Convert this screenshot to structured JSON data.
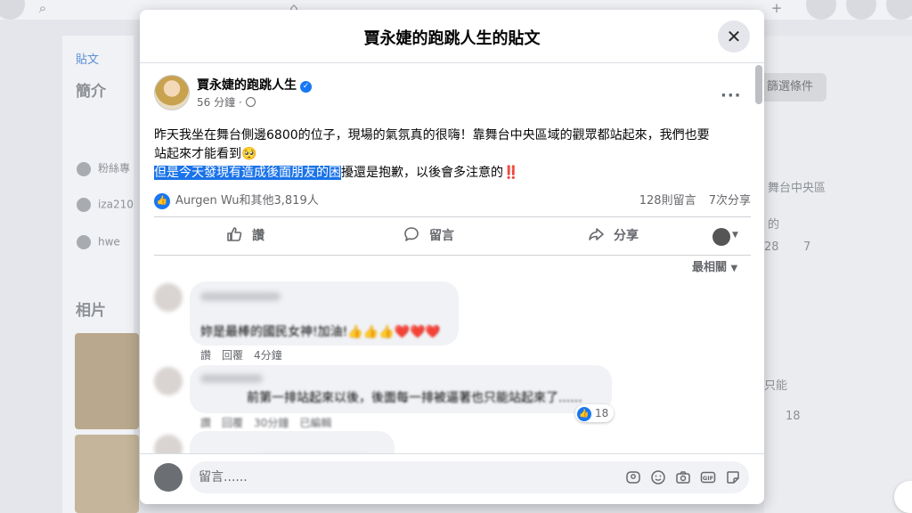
{
  "background": {
    "left_tabs": {
      "posts": "貼文"
    },
    "left_intro_heading": "簡介",
    "left_rows": [
      {
        "icon": "info-icon",
        "text": "粉絲專"
      },
      {
        "icon": "mail-icon",
        "text": "iza210"
      },
      {
        "icon": "globe-icon",
        "text": "hwe"
      }
    ],
    "left_photos_heading": "相片",
    "right_filter": "篩選條件",
    "right_snippets": [
      "舞台中央區",
      "的",
      "只能",
      "18",
      "28",
      "7"
    ]
  },
  "modal": {
    "title": "賈永婕的跑跳人生的貼文",
    "close_icon": "✕"
  },
  "post": {
    "author": "賈永婕的跑跳人生",
    "time": "56 分鐘",
    "text_line1": "昨天我坐在舞台側邊6800的位子，現場的氣氛真的很嗨！靠舞台中央區域的觀眾都站起來，我們也要",
    "text_line2": "站起來才能看到",
    "text_line3_highlight": "但是今天發現有造成後面朋友的困",
    "text_line3_rest": "擾還是抱歉，以後會多注意的",
    "emoji_teary": "🥺",
    "emoji_bangs": "‼️",
    "reactions_label": "Aurgen Wu和其他3,819人",
    "comments_count": "128則留言",
    "shares_count": "7次分享",
    "actions": {
      "like": "讚",
      "comment": "留言",
      "share": "分享"
    },
    "sort_label": "最相關"
  },
  "comments": [
    {
      "text": "妳是最棒的國民女神!加油!👍👍👍❤️❤️❤️",
      "meta": [
        "讚",
        "回覆",
        "4分鐘"
      ]
    },
    {
      "text": "前第一排站起來以後，後面每一排被逼著也只能站起來了......",
      "meta": [
        "讚",
        "回覆",
        "30分鐘",
        "已編輯"
      ],
      "reaction_count": "18"
    }
  ],
  "composer": {
    "placeholder": "留言......",
    "icons": [
      "avatar-sticker-icon",
      "emoji-icon",
      "camera-icon",
      "gif-icon",
      "sticker-icon"
    ]
  },
  "colors": {
    "accent": "#1877f2",
    "highlight": "#1a73e8"
  }
}
